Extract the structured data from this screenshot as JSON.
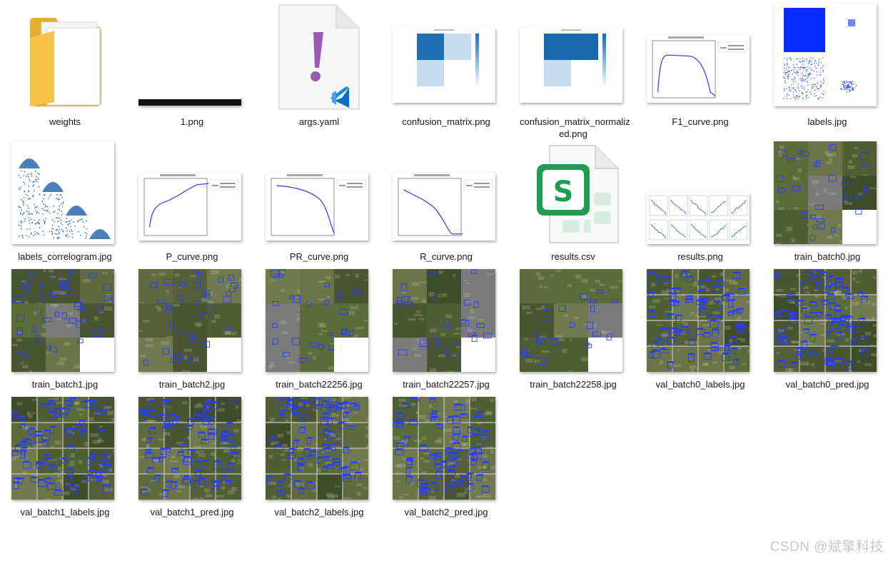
{
  "files": [
    {
      "name": "weights",
      "icon": "folder-icon"
    },
    {
      "name": "1.png",
      "icon": "image-thumbnail"
    },
    {
      "name": "args.yaml",
      "icon": "vscode-file-icon"
    },
    {
      "name": "confusion_matrix.png",
      "icon": "image-thumbnail"
    },
    {
      "name": "confusion_matrix_normaliz\ned.png",
      "icon": "image-thumbnail"
    },
    {
      "name": "F1_curve.png",
      "icon": "image-thumbnail"
    },
    {
      "name": "labels.jpg",
      "icon": "image-thumbnail"
    },
    {
      "name": "labels_correlogram.jpg",
      "icon": "image-thumbnail"
    },
    {
      "name": "P_curve.png",
      "icon": "image-thumbnail"
    },
    {
      "name": "PR_curve.png",
      "icon": "image-thumbnail"
    },
    {
      "name": "R_curve.png",
      "icon": "image-thumbnail"
    },
    {
      "name": "results.csv",
      "icon": "spreadsheet-file-icon"
    },
    {
      "name": "results.png",
      "icon": "image-thumbnail"
    },
    {
      "name": "train_batch0.jpg",
      "icon": "image-thumbnail"
    },
    {
      "name": "train_batch1.jpg",
      "icon": "image-thumbnail"
    },
    {
      "name": "train_batch2.jpg",
      "icon": "image-thumbnail"
    },
    {
      "name": "train_batch22256.jpg",
      "icon": "image-thumbnail"
    },
    {
      "name": "train_batch22257.jpg",
      "icon": "image-thumbnail"
    },
    {
      "name": "train_batch22258.jpg",
      "icon": "image-thumbnail"
    },
    {
      "name": "val_batch0_labels.jpg",
      "icon": "image-thumbnail"
    },
    {
      "name": "val_batch0_pred.jpg",
      "icon": "image-thumbnail"
    },
    {
      "name": "val_batch1_labels.jpg",
      "icon": "image-thumbnail"
    },
    {
      "name": "val_batch1_pred.jpg",
      "icon": "image-thumbnail"
    },
    {
      "name": "val_batch2_labels.jpg",
      "icon": "image-thumbnail"
    },
    {
      "name": "val_batch2_pred.jpg",
      "icon": "image-thumbnail"
    }
  ],
  "watermark": "CSDN @斌擎科技",
  "colors": {
    "folder": "#f5c24a",
    "vscode_blue": "#1e88e5",
    "yaml_mark": "#9b59b6",
    "sheet_green": "#1f9d55",
    "plot_line": "#3b4fe0",
    "matrix_dark": "#1f6eb0",
    "matrix_light": "#c6dcf0",
    "field_green": "#4f5e34",
    "label_box": "#2a3cff"
  }
}
